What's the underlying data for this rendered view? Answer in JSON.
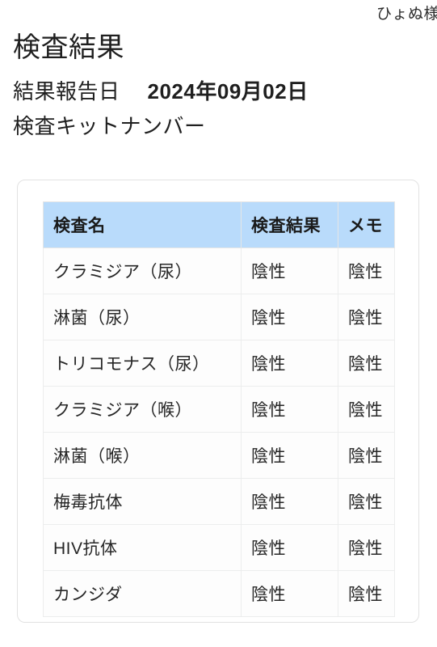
{
  "header": {
    "user_name": "ひょぬ様"
  },
  "page": {
    "title": "検査結果",
    "report_date_label": "結果報告日",
    "report_date_value": "2024年09月02日",
    "kit_number_label": "検査キットナンバー",
    "kit_number_value": ""
  },
  "table": {
    "columns": [
      "検査名",
      "検査結果",
      "メモ"
    ],
    "rows": [
      {
        "name": "クラミジア（尿）",
        "result": "陰性",
        "memo": "陰性"
      },
      {
        "name": "淋菌（尿）",
        "result": "陰性",
        "memo": "陰性"
      },
      {
        "name": "トリコモナス（尿）",
        "result": "陰性",
        "memo": "陰性"
      },
      {
        "name": "クラミジア（喉）",
        "result": "陰性",
        "memo": "陰性"
      },
      {
        "name": "淋菌（喉）",
        "result": "陰性",
        "memo": "陰性"
      },
      {
        "name": "梅毒抗体",
        "result": "陰性",
        "memo": "陰性"
      },
      {
        "name": "HIV抗体",
        "result": "陰性",
        "memo": "陰性"
      },
      {
        "name": "カンジダ",
        "result": "陰性",
        "memo": "陰性"
      }
    ]
  },
  "colors": {
    "header_row_bg": "#b9dbfb",
    "card_border": "#e2e2e2",
    "cell_border": "#eceded",
    "text": "#262626",
    "page_bg": "#ffffff"
  }
}
